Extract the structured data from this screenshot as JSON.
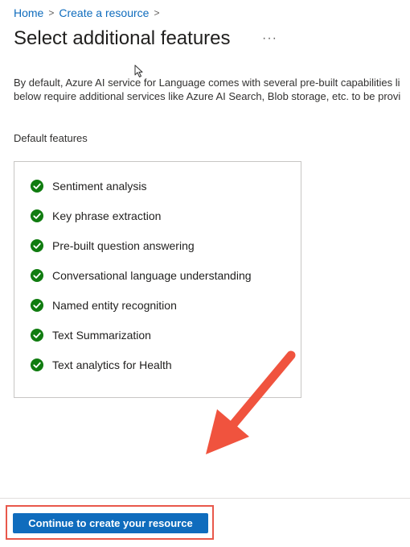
{
  "breadcrumb": {
    "items": [
      "Home",
      "Create a resource"
    ],
    "separator": ">"
  },
  "page": {
    "title": "Select additional features",
    "more_label": "···",
    "description_lines": [
      "By default, Azure AI service for Language comes with several pre-built capabilities li",
      "below require additional services like Azure AI Search, Blob storage, etc. to be provi"
    ]
  },
  "default_features": {
    "label": "Default features",
    "items": [
      "Sentiment analysis",
      "Key phrase extraction",
      "Pre-built question answering",
      "Conversational language understanding",
      "Named entity recognition",
      "Text Summarization",
      "Text analytics for Health"
    ]
  },
  "footer": {
    "continue_label": "Continue to create your resource"
  },
  "colors": {
    "accent": "#0f6cbd",
    "check": "#107c10",
    "annotation": "#e8584b"
  },
  "icons": {
    "feature_status": "check-circle-icon",
    "breadcrumb_separator": "chevron-right-icon",
    "annotation": "red-arrow-pointer"
  }
}
